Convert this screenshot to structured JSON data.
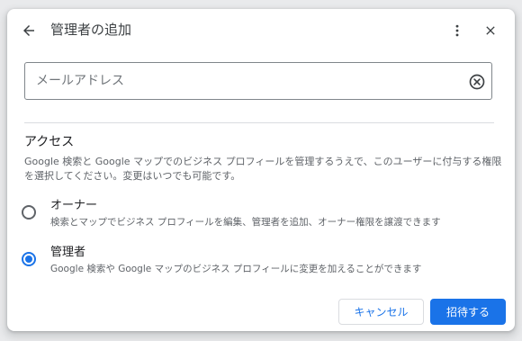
{
  "dialog": {
    "title": "管理者の追加",
    "icons": {
      "back": "arrow-back-icon",
      "more": "more-vert-icon",
      "close": "close-icon",
      "clear": "clear-circle-icon"
    }
  },
  "email_field": {
    "placeholder": "メールアドレス",
    "value": ""
  },
  "access": {
    "title": "アクセス",
    "description": "Google 検索と Google マップでのビジネス プロフィールを管理するうえで、このユーザーに付与する権限を選択してください。変更はいつでも可能です。",
    "options": [
      {
        "label": "オーナー",
        "description": "検索とマップでビジネス プロフィールを編集、管理者を追加、オーナー権限を譲渡できます",
        "selected": false
      },
      {
        "label": "管理者",
        "description": "Google 検索や Google マップのビジネス プロフィールに変更を加えることができます",
        "selected": true
      }
    ]
  },
  "actions": {
    "cancel_label": "キャンセル",
    "invite_label": "招待する"
  },
  "colors": {
    "accent": "#1a73e8",
    "text_primary": "#202124",
    "text_secondary": "#5f6368",
    "divider": "#dadce0"
  }
}
